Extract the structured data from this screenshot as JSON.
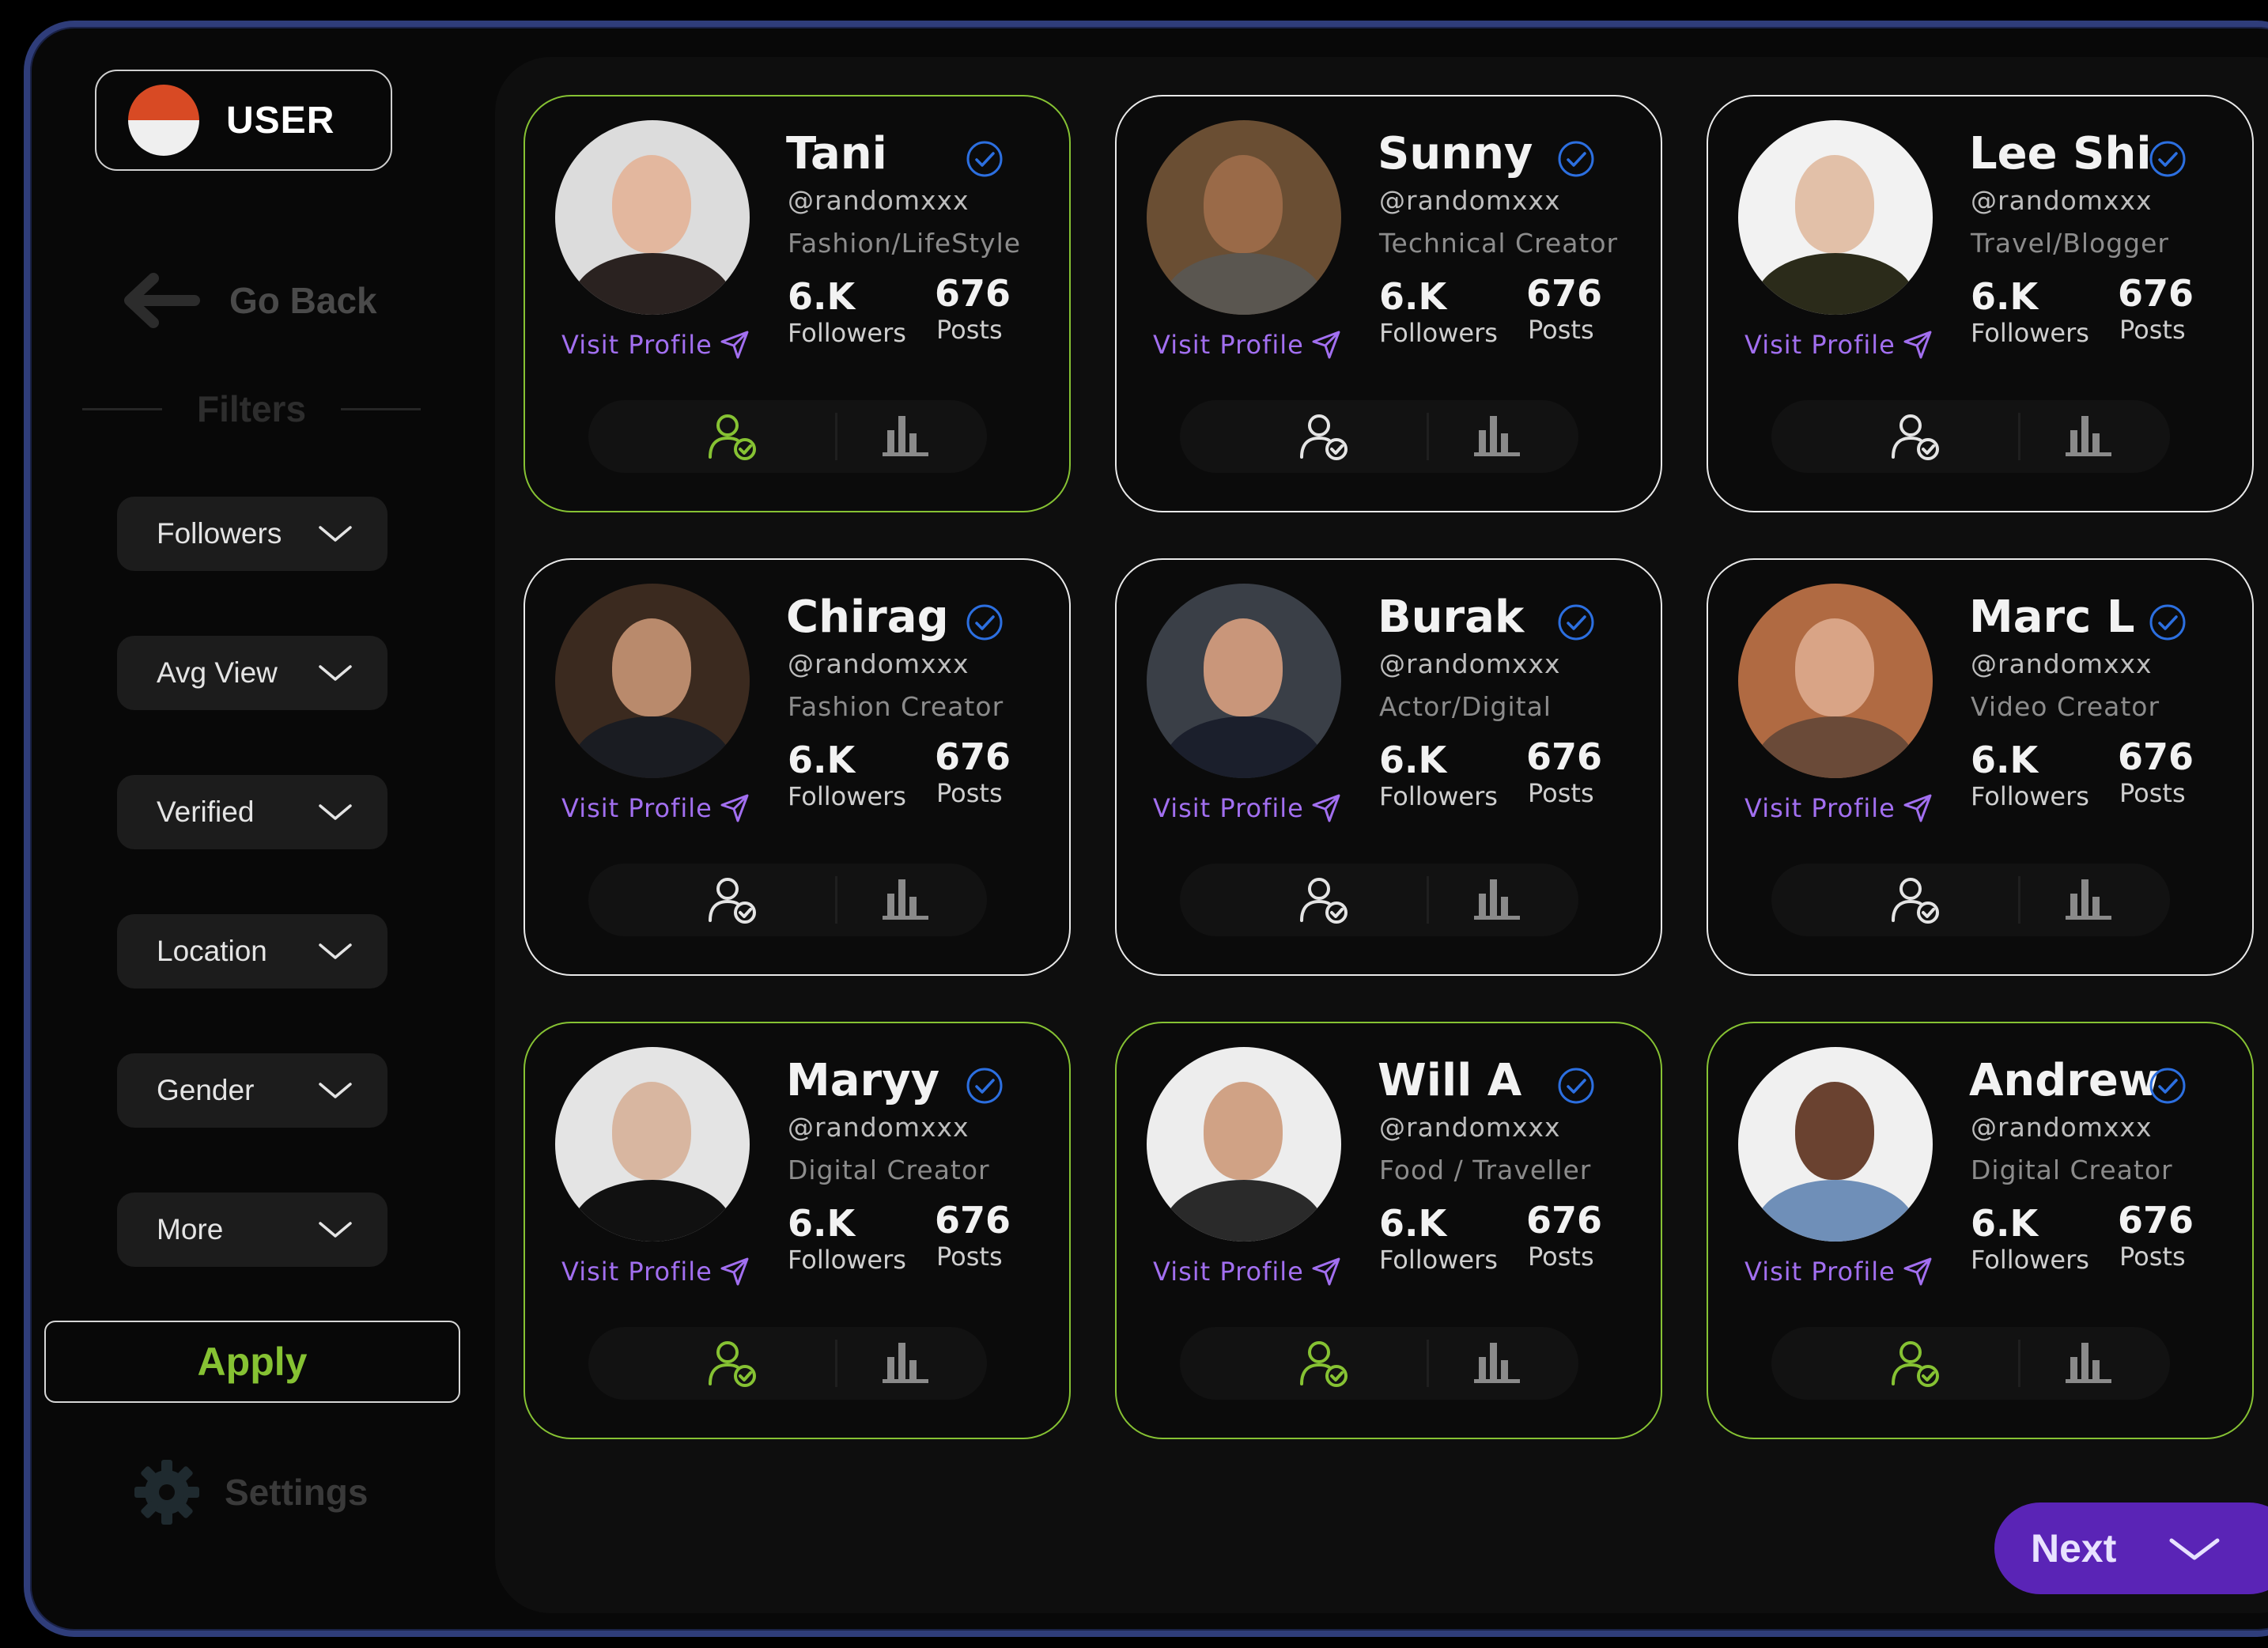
{
  "sidebar": {
    "user_label": "USER",
    "go_back_label": "Go Back",
    "filters_heading": "Filters",
    "filters": [
      {
        "label": "Followers"
      },
      {
        "label": "Avg  View"
      },
      {
        "label": "Verified"
      },
      {
        "label": "Location"
      },
      {
        "label": "Gender"
      },
      {
        "label": "More"
      }
    ],
    "apply_label": "Apply",
    "settings_label": "Settings"
  },
  "cards": [
    {
      "name": "Tani",
      "handle": "@randomxxx",
      "category": "Fashion/LifeStyle",
      "followers_value": "6.K",
      "followers_label": "Followers",
      "posts_value": "676",
      "posts_label": "Posts",
      "visit_label": "Visit Profile",
      "followed": true
    },
    {
      "name": "Sunny",
      "handle": "@randomxxx",
      "category": "Technical Creator",
      "followers_value": "6.K",
      "followers_label": "Followers",
      "posts_value": "676",
      "posts_label": "Posts",
      "visit_label": "Visit Profile",
      "followed": false
    },
    {
      "name": "Lee Shi",
      "handle": "@randomxxx",
      "category": "Travel/Blogger",
      "followers_value": "6.K",
      "followers_label": "Followers",
      "posts_value": "676",
      "posts_label": "Posts",
      "visit_label": "Visit Profile",
      "followed": false
    },
    {
      "name": "Chirag",
      "handle": "@randomxxx",
      "category": "Fashion Creator",
      "followers_value": "6.K",
      "followers_label": "Followers",
      "posts_value": "676",
      "posts_label": "Posts",
      "visit_label": "Visit Profile",
      "followed": false
    },
    {
      "name": "Burak",
      "handle": "@randomxxx",
      "category": "Actor/Digital",
      "followers_value": "6.K",
      "followers_label": "Followers",
      "posts_value": "676",
      "posts_label": "Posts",
      "visit_label": "Visit Profile",
      "followed": false
    },
    {
      "name": "Marc L",
      "handle": "@randomxxx",
      "category": "Video Creator",
      "followers_value": "6.K",
      "followers_label": "Followers",
      "posts_value": "676",
      "posts_label": "Posts",
      "visit_label": "Visit Profile",
      "followed": false
    },
    {
      "name": "Maryy",
      "handle": "@randomxxx",
      "category": "Digital Creator",
      "followers_value": "6.K",
      "followers_label": "Followers",
      "posts_value": "676",
      "posts_label": "Posts",
      "visit_label": "Visit Profile",
      "followed": true
    },
    {
      "name": "Will A",
      "handle": "@randomxxx",
      "category": "Food / Traveller",
      "followers_value": "6.K",
      "followers_label": "Followers",
      "posts_value": "676",
      "posts_label": "Posts",
      "visit_label": "Visit Profile",
      "followed": true
    },
    {
      "name": "Andrew",
      "handle": "@randomxxx",
      "category": "Digital Creator",
      "followers_value": "6.K",
      "followers_label": "Followers",
      "posts_value": "676",
      "posts_label": "Posts",
      "visit_label": "Visit Profile",
      "followed": true
    }
  ],
  "next_label": "Next",
  "colors": {
    "accent_green": "#86c233",
    "accent_purple": "#a26ff0",
    "verified_blue": "#2c6fe0",
    "next_button": "#5a24b6"
  }
}
